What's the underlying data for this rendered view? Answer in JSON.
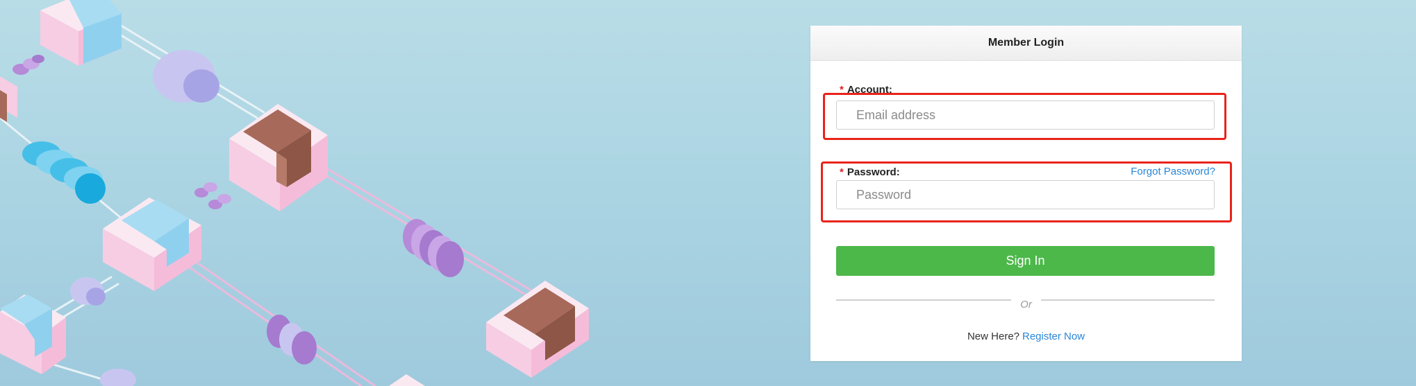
{
  "login": {
    "title": "Member Login",
    "account_label": "Account:",
    "account_placeholder": "Email address",
    "password_label": "Password:",
    "password_placeholder": "Password",
    "forgot_password": "Forgot Password?",
    "required_marker": "*",
    "sign_in_label": "Sign In",
    "or_text": "Or",
    "new_here_text": "New Here?",
    "register_link": "Register Now"
  },
  "colors": {
    "background": "#b9dde7",
    "sign_in_button": "#4cb84a",
    "link": "#2a86d6",
    "highlight_box": "#e8231a"
  }
}
